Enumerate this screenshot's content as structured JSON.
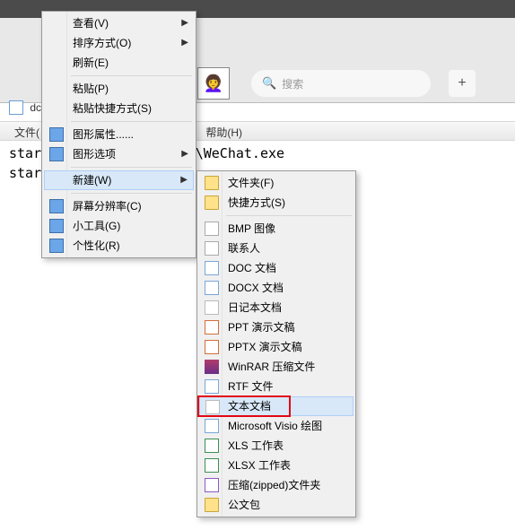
{
  "top": {
    "search_placeholder": "搜索",
    "plus": "+"
  },
  "window": {
    "title": "dc",
    "file_menu": "文件(",
    "help_menu": "帮助(H)"
  },
  "lines": {
    "l1": "star                                    5)\"\\Tencent\\WeChat\\WeChat.exe",
    "l2": "star                                                                :hat.exe"
  },
  "menu1": {
    "view": "查看(V)",
    "sort": "排序方式(O)",
    "refresh": "刷新(E)",
    "paste": "粘贴(P)",
    "paste_shortcut": "粘贴快捷方式(S)",
    "gfx_props": "图形属性......",
    "gfx_opts": "图形选项",
    "new": "新建(W)",
    "screen_res": "屏幕分辨率(C)",
    "gadgets": "小工具(G)",
    "personalize": "个性化(R)"
  },
  "menu2": {
    "folder": "文件夹(F)",
    "shortcut": "快捷方式(S)",
    "bmp": "BMP 图像",
    "contact": "联系人",
    "doc": "DOC 文档",
    "docx": "DOCX 文档",
    "journal": "日记本文档",
    "ppt": "PPT 演示文稿",
    "pptx": "PPTX 演示文稿",
    "winrar": "WinRAR 压缩文件",
    "rtf": "RTF 文件",
    "txt": "文本文档",
    "visio": "Microsoft Visio 绘图",
    "xls": "XLS 工作表",
    "xlsx": "XLSX 工作表",
    "zip": "压缩(zipped)文件夹",
    "briefcase": "公文包"
  }
}
